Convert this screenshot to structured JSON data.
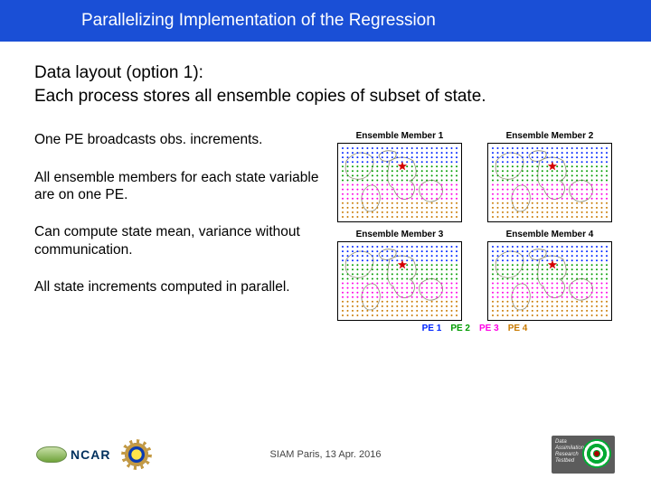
{
  "title": "Parallelizing Implementation of the Regression",
  "intro_line1": "Data layout (option 1):",
  "intro_line2": "Each process stores all ensemble copies of subset of state.",
  "bullets": {
    "b1": "One PE broadcasts obs. increments.",
    "b2": "All ensemble members for each state variable are on one PE.",
    "b3": "Can compute state mean, variance without communication.",
    "b4": "All state increments computed in parallel."
  },
  "panels": {
    "p1": "Ensemble Member 1",
    "p2": "Ensemble Member 2",
    "p3": "Ensemble Member 3",
    "p4": "Ensemble Member 4"
  },
  "legend": {
    "l1": "PE 1",
    "l2": "PE 2",
    "l3": "PE 3",
    "l4": "PE 4"
  },
  "footer": {
    "center": "SIAM Paris, 13 Apr. 2016",
    "ncar": "NCAR",
    "dares_l1": "Data",
    "dares_l2": "Assimilation",
    "dares_l3": "Research",
    "dares_l4": "Testbed"
  },
  "colors": {
    "pe1": "#0026ff",
    "pe2": "#009b00",
    "pe3": "#ff00e6",
    "pe4": "#c97a00"
  }
}
